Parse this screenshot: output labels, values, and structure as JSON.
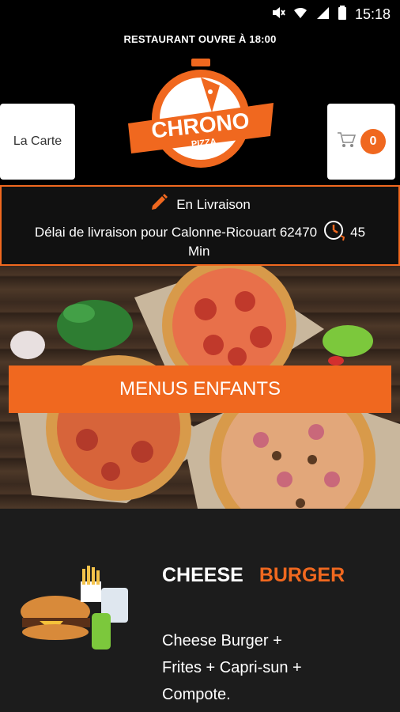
{
  "status_bar": {
    "time": "15:18",
    "icons": [
      "mute-icon",
      "wifi-icon",
      "signal-icon",
      "battery-icon"
    ]
  },
  "header": {
    "open_banner": "RESTAURANT OUVRE À 18:00",
    "menu_button_label": "La Carte",
    "cart_count": "0",
    "logo_text": "CHRONO",
    "logo_subtext": "PIZZA"
  },
  "delivery": {
    "mode": "En Livraison",
    "delay_text": "Délai de livraison pour Calonne-Ricouart 62470",
    "delay_value": "45",
    "delay_unit": "Min"
  },
  "category": {
    "title": "MENUS ENFANTS"
  },
  "product": {
    "title_part1": "CHEESE",
    "title_part2": "BURGER",
    "description": "Cheese Burger + Frites + Capri-sun + Compote."
  },
  "colors": {
    "accent": "#f0681f",
    "background": "#000000",
    "panel": "#1c1c1c"
  }
}
